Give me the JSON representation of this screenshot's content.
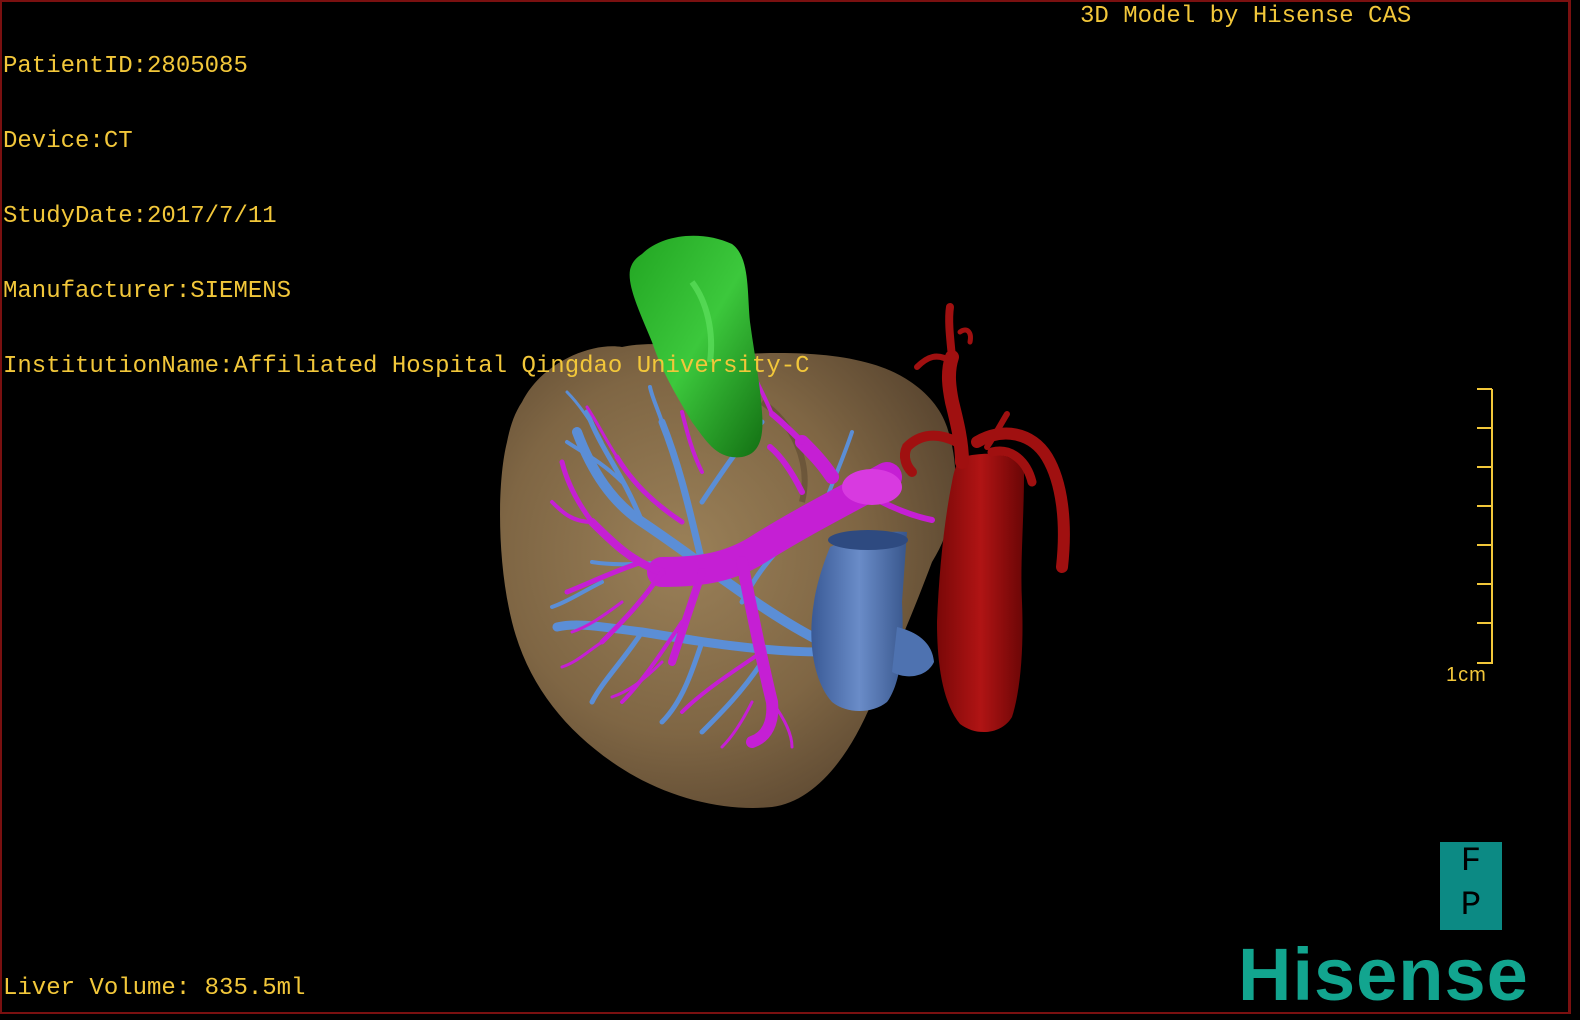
{
  "info": {
    "patient_id": "PatientID:2805085",
    "device": "Device:CT",
    "study_date": "StudyDate:2017/7/11",
    "manufacturer": "Manufacturer:SIEMENS",
    "institution": "InstitutionName:Affiliated Hospital Qingdao University-C"
  },
  "credit": "3D Model by Hisense CAS",
  "liver_volume": "Liver Volume: 835.5ml",
  "scale": {
    "label": "1cm"
  },
  "orientation": {
    "top": "F",
    "bottom": "P"
  },
  "brand": "Hisense",
  "colors": {
    "text": "#f2c73a",
    "border": "#7a1010",
    "liver": "#8b7250",
    "gallbladder": "#1f9a1f",
    "portal_vein": "#c21fd0",
    "hepatic_vein": "#5a8ad0",
    "vena_cava": "#4a6aa8",
    "aorta": "#9a0c0c",
    "brand": "#12a58f"
  },
  "structures": [
    "liver",
    "gallbladder",
    "portal-vein",
    "hepatic-vein",
    "inferior-vena-cava",
    "aorta"
  ]
}
